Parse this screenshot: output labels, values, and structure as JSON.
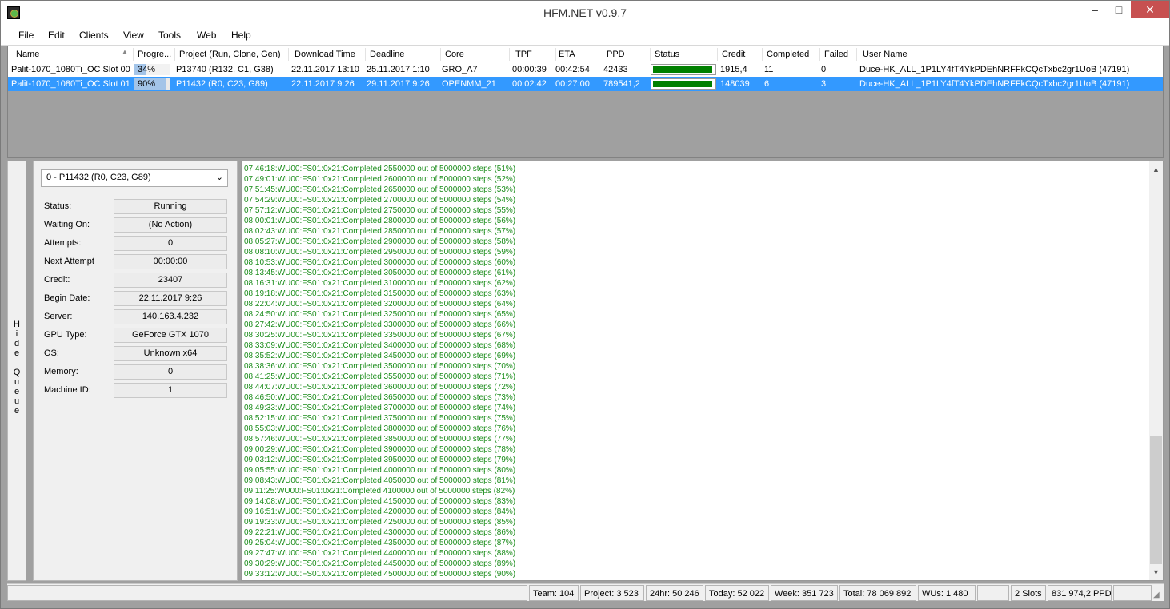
{
  "window": {
    "title": "HFM.NET v0.9.7"
  },
  "menu": [
    "File",
    "Edit",
    "Clients",
    "View",
    "Tools",
    "Web",
    "Help"
  ],
  "grid": {
    "columns": [
      "Name",
      "Progre...",
      "Project (Run, Clone, Gen)",
      "Download Time",
      "Deadline",
      "Core",
      "TPF",
      "ETA",
      "PPD",
      "Status",
      "Credit",
      "Completed",
      "Failed",
      "User Name"
    ],
    "rows": [
      {
        "name": "Palit-1070_1080Ti_OC Slot 00",
        "progress": "34%",
        "progress_value": 0.34,
        "project": "P13740 (R132, C1, G38)",
        "download": "22.11.2017 13:10",
        "deadline": "25.11.2017 1:10",
        "core": "GRO_A7",
        "tpf": "00:00:39",
        "eta": "00:42:54",
        "ppd": "42433",
        "status_color": "#008000",
        "credit": "1915,4",
        "completed": "11",
        "failed": "0",
        "user": "Duce-HK_ALL_1P1LY4fT4YkPDEhNRFFkCQcTxbc2gr1UoB (47191)",
        "selected": false
      },
      {
        "name": "Palit-1070_1080Ti_OC Slot 01",
        "progress": "90%",
        "progress_value": 0.9,
        "project": "P11432 (R0, C23, G89)",
        "download": "22.11.2017 9:26",
        "deadline": "29.11.2017 9:26",
        "core": "OPENMM_21",
        "tpf": "00:02:42",
        "eta": "00:27:00",
        "ppd": "789541,2",
        "status_color": "#008000",
        "credit": "148039",
        "completed": "6",
        "failed": "3",
        "user": "Duce-HK_ALL_1P1LY4fT4YkPDEhNRFFkCQcTxbc2gr1UoB (47191)",
        "selected": true
      }
    ]
  },
  "hide_queue": [
    "H",
    "i",
    "d",
    "e",
    "",
    "Q",
    "u",
    "e",
    "u",
    "e"
  ],
  "queue": {
    "selected": "0 - P11432 (R0, C23, G89)",
    "fields": [
      {
        "label": "Status:",
        "value": "Running"
      },
      {
        "label": "Waiting On:",
        "value": "(No Action)"
      },
      {
        "label": "Attempts:",
        "value": "0"
      },
      {
        "label": "Next Attempt",
        "value": "00:00:00"
      },
      {
        "label": "Credit:",
        "value": "23407"
      },
      {
        "label": "Begin Date:",
        "value": "22.11.2017 9:26"
      },
      {
        "label": "Server:",
        "value": "140.163.4.232"
      },
      {
        "label": "GPU Type:",
        "value": "GeForce GTX 1070"
      },
      {
        "label": "OS:",
        "value": "Unknown x64"
      },
      {
        "label": "Memory:",
        "value": "0"
      },
      {
        "label": "Machine ID:",
        "value": "1"
      }
    ]
  },
  "log": [
    "07:46:18:WU00:FS01:0x21:Completed 2550000 out of 5000000 steps (51%)",
    "07:49:01:WU00:FS01:0x21:Completed 2600000 out of 5000000 steps (52%)",
    "07:51:45:WU00:FS01:0x21:Completed 2650000 out of 5000000 steps (53%)",
    "07:54:29:WU00:FS01:0x21:Completed 2700000 out of 5000000 steps (54%)",
    "07:57:12:WU00:FS01:0x21:Completed 2750000 out of 5000000 steps (55%)",
    "08:00:01:WU00:FS01:0x21:Completed 2800000 out of 5000000 steps (56%)",
    "08:02:43:WU00:FS01:0x21:Completed 2850000 out of 5000000 steps (57%)",
    "08:05:27:WU00:FS01:0x21:Completed 2900000 out of 5000000 steps (58%)",
    "08:08:10:WU00:FS01:0x21:Completed 2950000 out of 5000000 steps (59%)",
    "08:10:53:WU00:FS01:0x21:Completed 3000000 out of 5000000 steps (60%)",
    "08:13:45:WU00:FS01:0x21:Completed 3050000 out of 5000000 steps (61%)",
    "08:16:31:WU00:FS01:0x21:Completed 3100000 out of 5000000 steps (62%)",
    "08:19:18:WU00:FS01:0x21:Completed 3150000 out of 5000000 steps (63%)",
    "08:22:04:WU00:FS01:0x21:Completed 3200000 out of 5000000 steps (64%)",
    "08:24:50:WU00:FS01:0x21:Completed 3250000 out of 5000000 steps (65%)",
    "08:27:42:WU00:FS01:0x21:Completed 3300000 out of 5000000 steps (66%)",
    "08:30:25:WU00:FS01:0x21:Completed 3350000 out of 5000000 steps (67%)",
    "08:33:09:WU00:FS01:0x21:Completed 3400000 out of 5000000 steps (68%)",
    "08:35:52:WU00:FS01:0x21:Completed 3450000 out of 5000000 steps (69%)",
    "08:38:36:WU00:FS01:0x21:Completed 3500000 out of 5000000 steps (70%)",
    "08:41:25:WU00:FS01:0x21:Completed 3550000 out of 5000000 steps (71%)",
    "08:44:07:WU00:FS01:0x21:Completed 3600000 out of 5000000 steps (72%)",
    "08:46:50:WU00:FS01:0x21:Completed 3650000 out of 5000000 steps (73%)",
    "08:49:33:WU00:FS01:0x21:Completed 3700000 out of 5000000 steps (74%)",
    "08:52:15:WU00:FS01:0x21:Completed 3750000 out of 5000000 steps (75%)",
    "08:55:03:WU00:FS01:0x21:Completed 3800000 out of 5000000 steps (76%)",
    "08:57:46:WU00:FS01:0x21:Completed 3850000 out of 5000000 steps (77%)",
    "09:00:29:WU00:FS01:0x21:Completed 3900000 out of 5000000 steps (78%)",
    "09:03:12:WU00:FS01:0x21:Completed 3950000 out of 5000000 steps (79%)",
    "09:05:55:WU00:FS01:0x21:Completed 4000000 out of 5000000 steps (80%)",
    "09:08:43:WU00:FS01:0x21:Completed 4050000 out of 5000000 steps (81%)",
    "09:11:25:WU00:FS01:0x21:Completed 4100000 out of 5000000 steps (82%)",
    "09:14:08:WU00:FS01:0x21:Completed 4150000 out of 5000000 steps (83%)",
    "09:16:51:WU00:FS01:0x21:Completed 4200000 out of 5000000 steps (84%)",
    "09:19:33:WU00:FS01:0x21:Completed 4250000 out of 5000000 steps (85%)",
    "09:22:21:WU00:FS01:0x21:Completed 4300000 out of 5000000 steps (86%)",
    "09:25:04:WU00:FS01:0x21:Completed 4350000 out of 5000000 steps (87%)",
    "09:27:47:WU00:FS01:0x21:Completed 4400000 out of 5000000 steps (88%)",
    "09:30:29:WU00:FS01:0x21:Completed 4450000 out of 5000000 steps (89%)",
    "09:33:12:WU00:FS01:0x21:Completed 4500000 out of 5000000 steps (90%)"
  ],
  "statusbar": [
    "Team: 104",
    "Project: 3 523",
    "24hr: 50 246",
    "Today: 52 022",
    "Week: 351 723",
    "Total: 78 069 892",
    "WUs: 1 480",
    "",
    "2 Slots",
    "831 974,2 PPD",
    ""
  ]
}
